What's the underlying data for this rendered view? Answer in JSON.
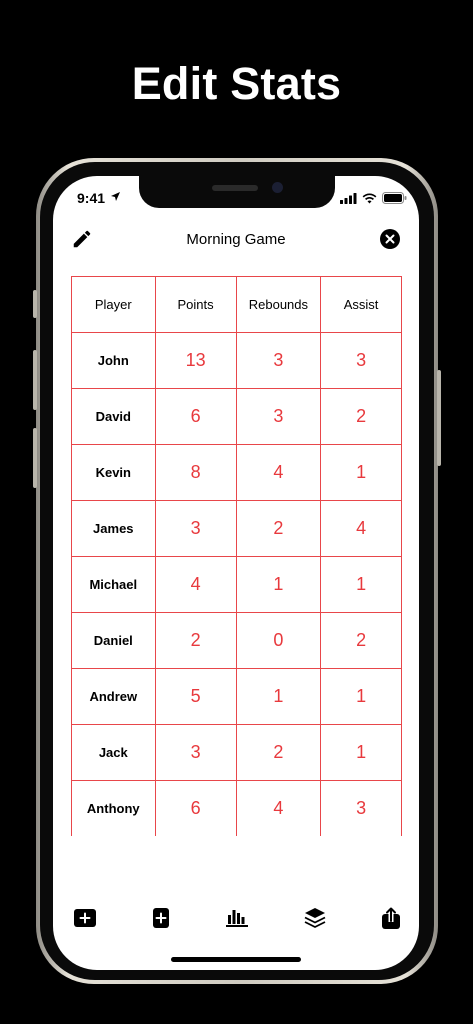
{
  "headline": "Edit Stats",
  "status_bar": {
    "time": "9:41"
  },
  "nav": {
    "title": "Morning Game"
  },
  "table": {
    "headers": [
      "Player",
      "Points",
      "Rebounds",
      "Assist"
    ],
    "rows": [
      {
        "player": "John",
        "points": "13",
        "rebounds": "3",
        "assists": "3"
      },
      {
        "player": "David",
        "points": "6",
        "rebounds": "3",
        "assists": "2"
      },
      {
        "player": "Kevin",
        "points": "8",
        "rebounds": "4",
        "assists": "1"
      },
      {
        "player": "James",
        "points": "3",
        "rebounds": "2",
        "assists": "4"
      },
      {
        "player": "Michael",
        "points": "4",
        "rebounds": "1",
        "assists": "1"
      },
      {
        "player": "Daniel",
        "points": "2",
        "rebounds": "0",
        "assists": "2"
      },
      {
        "player": "Andrew",
        "points": "5",
        "rebounds": "1",
        "assists": "1"
      },
      {
        "player": "Jack",
        "points": "3",
        "rebounds": "2",
        "assists": "1"
      },
      {
        "player": "Anthony",
        "points": "6",
        "rebounds": "4",
        "assists": "3"
      }
    ]
  },
  "colors": {
    "accent": "#e8393d",
    "grid": "#e8464a",
    "background": "#000000"
  },
  "toolbar_icons": [
    "add-row-icon",
    "add-column-icon",
    "chart-icon",
    "layers-icon",
    "share-icon"
  ]
}
